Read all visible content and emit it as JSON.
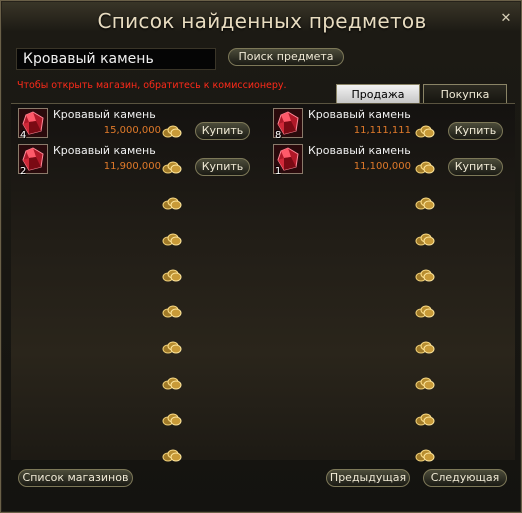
{
  "window": {
    "title": "Список найденных предметов"
  },
  "search": {
    "value": "Кровавый камень",
    "button_label": "Поиск предмета"
  },
  "notice": "Чтобы открыть магазин, обратитесь к комиссионеру.",
  "tabs": [
    {
      "label": "Продажа",
      "active": true
    },
    {
      "label": "Покупка",
      "active": false
    }
  ],
  "left_column": [
    {
      "name": "Кровавый камень",
      "quantity": "4",
      "price": "15,000,000",
      "buy_label": "Купить",
      "icon": "blood-stone-icon"
    },
    {
      "name": "Кровавый камень",
      "quantity": "2",
      "price": "11,900,000",
      "buy_label": "Купить",
      "icon": "blood-stone-icon"
    }
  ],
  "right_column": [
    {
      "name": "Кровавый камень",
      "quantity": "8",
      "price": "11,111,111",
      "buy_label": "Купить",
      "icon": "blood-stone-icon"
    },
    {
      "name": "Кровавый камень",
      "quantity": "1",
      "price": "11,100,000",
      "buy_label": "Купить",
      "icon": "blood-stone-icon"
    }
  ],
  "empty_slots_per_column": 8,
  "footer": {
    "shop_list_label": "Список магазинов",
    "prev_label": "Предыдущая",
    "next_label": "Следующая"
  },
  "colors": {
    "price": "#e07a2a",
    "notice": "#ff2a1a",
    "title": "#e8dcc0"
  }
}
